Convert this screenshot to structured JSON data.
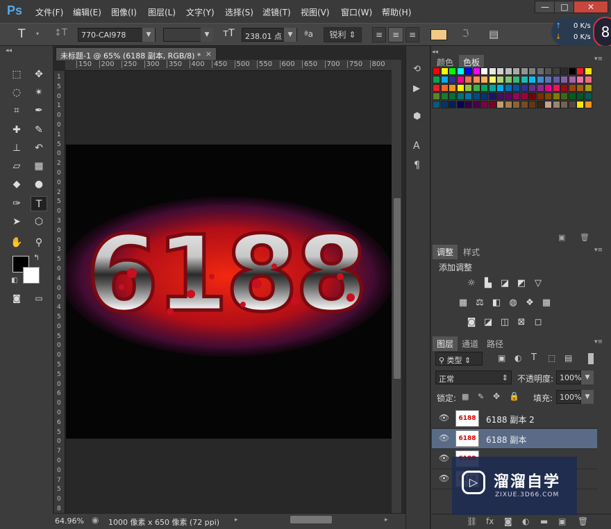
{
  "app": {
    "logo": "Ps"
  },
  "menu": [
    "文件(F)",
    "编辑(E)",
    "图像(I)",
    "图层(L)",
    "文字(Y)",
    "选择(S)",
    "滤镜(T)",
    "视图(V)",
    "窗口(W)",
    "帮助(H)"
  ],
  "window_buttons": {
    "minimize": "—",
    "maximize": "□",
    "close": "✕"
  },
  "options": {
    "tool_icon": "T",
    "font_family": "770-CAI978",
    "font_style": "",
    "font_size": "238.01 点",
    "aa_label": "ªa",
    "antialias": "锐利",
    "text_color": "#f3c987"
  },
  "network": {
    "up": "0 K/s",
    "down": "0 K/s",
    "badge": "8"
  },
  "document": {
    "tab_title": "未标题-1 @ 65% (6188 副本, RGB/8) *",
    "zoom": "64.96%",
    "info": "1000 像素 x 650 像素 (72 ppi)",
    "canvas_text": "6188"
  },
  "ruler_h": [
    "150",
    "200",
    "250",
    "300",
    "350",
    "400",
    "450",
    "500",
    "550",
    "600",
    "650",
    "700",
    "750",
    "800"
  ],
  "ruler_v": [
    "1",
    "5",
    "0",
    "1",
    "0",
    "0",
    "1",
    "5",
    "0",
    "2",
    "0",
    "0",
    "2",
    "5",
    "0",
    "3",
    "0",
    "0",
    "3",
    "5",
    "0",
    "4",
    "0",
    "0",
    "4",
    "5",
    "0",
    "5",
    "0",
    "0",
    "5",
    "5",
    "0",
    "6",
    "0",
    "0",
    "6",
    "5",
    "0",
    "7",
    "0",
    "0",
    "7",
    "5",
    "0",
    "8"
  ],
  "color_panel": {
    "tabs": [
      "颜色",
      "色板"
    ],
    "active": "色板"
  },
  "adjust_panel": {
    "tabs": [
      "调整",
      "样式"
    ],
    "active": "调整",
    "title": "添加调整"
  },
  "layers_panel": {
    "tabs": [
      "图层",
      "通道",
      "路径"
    ],
    "active": "图层",
    "filter_label": "类型",
    "blend_mode": "正常",
    "opacity_label": "不透明度:",
    "opacity": "100%",
    "lock_label": "锁定:",
    "fill_label": "填充:",
    "fill": "100%",
    "layers": [
      {
        "name": "6188 副本 2",
        "selected": false
      },
      {
        "name": "6188 副本",
        "selected": true
      },
      {
        "name": "",
        "selected": false
      },
      {
        "name": "",
        "selected": false
      }
    ]
  },
  "watermark": {
    "title": "溜溜自学",
    "url": "ZIXUE.3D66.COM"
  },
  "swatches": [
    "#ff0000",
    "#ffff00",
    "#00ff00",
    "#00ffff",
    "#0000ff",
    "#ff00ff",
    "#ffffff",
    "#e6e6e6",
    "#d0d0d0",
    "#bdbdbd",
    "#aaaaaa",
    "#949494",
    "#808080",
    "#6b6b6b",
    "#555555",
    "#404040",
    "#2b2b2b",
    "#000000",
    "#ed1c24",
    "#ffe600",
    "#00a651",
    "#00aeef",
    "#2e3192",
    "#ec008c",
    "#f26c4f",
    "#f68e55",
    "#fbaf5c",
    "#fff467",
    "#acd372",
    "#7cc576",
    "#3bb878",
    "#1abbb4",
    "#00bff3",
    "#438ccb",
    "#5574b9",
    "#605ca8",
    "#855fa8",
    "#a763a8",
    "#f06eaa",
    "#f26d7d",
    "#ee1d24",
    "#f16522",
    "#f7941d",
    "#fff100",
    "#8dc63f",
    "#39b54a",
    "#00a651",
    "#00a99d",
    "#00aeef",
    "#0072bc",
    "#0054a6",
    "#2e3192",
    "#662d91",
    "#92278f",
    "#ec008c",
    "#ed145b",
    "#9e0b0f",
    "#a0410d",
    "#a3620a",
    "#aba000",
    "#598527",
    "#1a7b30",
    "#007236",
    "#00746b",
    "#0076a3",
    "#004b80",
    "#003471",
    "#1b1464",
    "#440e62",
    "#630460",
    "#9e005d",
    "#9e0039",
    "#790000",
    "#7b2e00",
    "#7d4900",
    "#827b00",
    "#406618",
    "#005e20",
    "#005826",
    "#005952",
    "#005b7f",
    "#003663",
    "#002157",
    "#0d004c",
    "#32004b",
    "#4b0049",
    "#7b0046",
    "#7a0026",
    "#c69c6e",
    "#a67c52",
    "#8c6239",
    "#754c24",
    "#603913",
    "#3c2415",
    "#c6a28e",
    "#998675",
    "#736357",
    "#534741",
    "#ffe600",
    "#f7941d"
  ]
}
